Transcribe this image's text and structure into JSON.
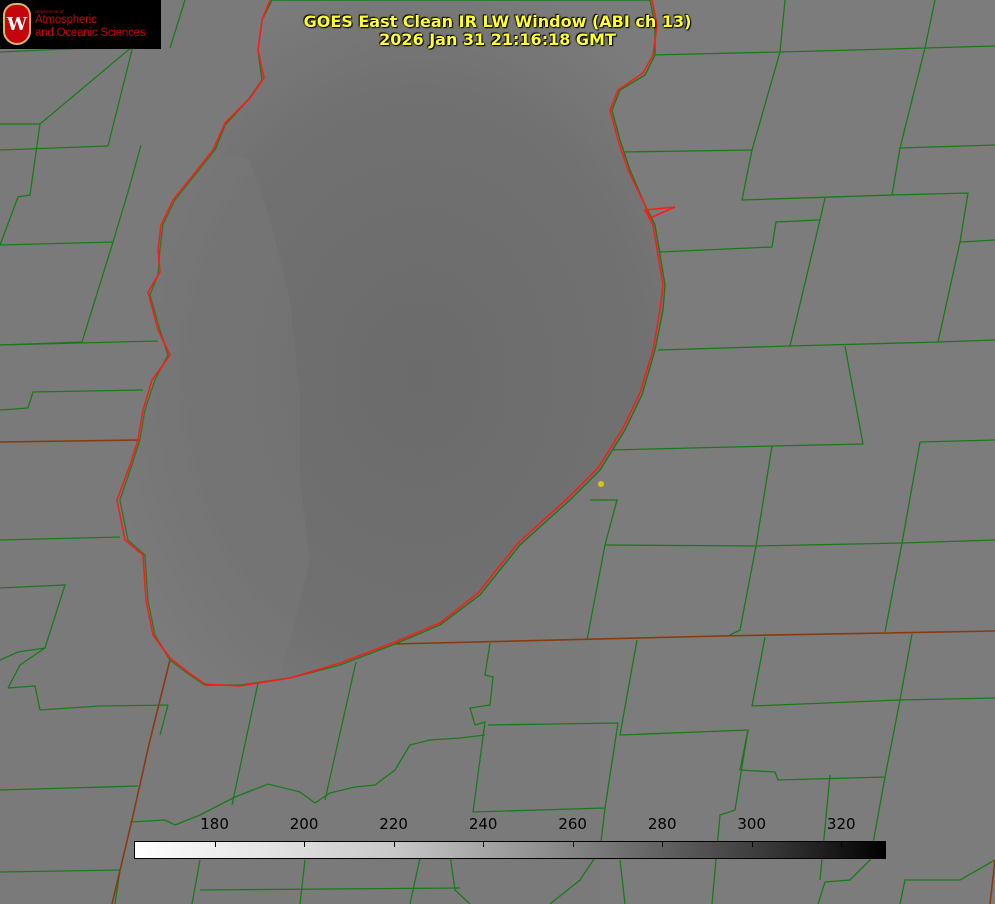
{
  "header": {
    "title_line1": "GOES East Clean IR LW Window (ABI ch 13)",
    "title_line2": "2026 Jan 31 21:16:18 GMT"
  },
  "logo": {
    "department_small": "Department of",
    "line1": "Atmospheric",
    "line2": "and Oceanic Sciences",
    "crest_letter": "W"
  },
  "colors": {
    "land": "#7a7a7a",
    "lake": "#6e6e6e",
    "boundary_green": "#1a7a1a",
    "state_line": "#8a3a10",
    "shoreline_red": "#ff1a1a",
    "title_yellow": "#ffff33",
    "marker_yellow": "#d9c21a"
  },
  "colorbar": {
    "min": 162,
    "max": 330,
    "ticks": [
      {
        "value": 180,
        "label": "180"
      },
      {
        "value": 200,
        "label": "200"
      },
      {
        "value": 220,
        "label": "220"
      },
      {
        "value": 240,
        "label": "240"
      },
      {
        "value": 260,
        "label": "260"
      },
      {
        "value": 280,
        "label": "280"
      },
      {
        "value": 300,
        "label": "300"
      },
      {
        "value": 320,
        "label": "320"
      }
    ]
  }
}
